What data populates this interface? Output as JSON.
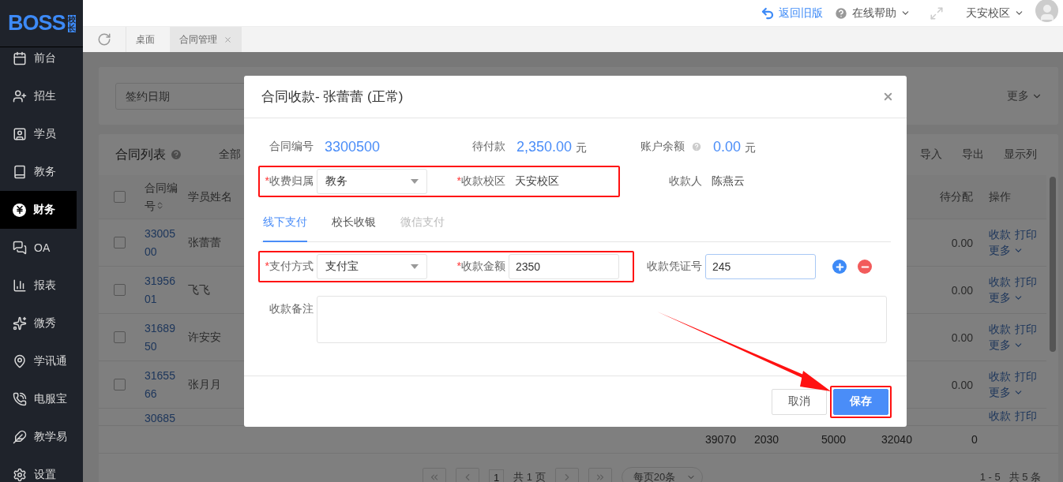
{
  "logo": {
    "text": "BOSS",
    "badge": "校长"
  },
  "sidebar": {
    "items": [
      {
        "label": "前台",
        "selected": false
      },
      {
        "label": "招生",
        "selected": false
      },
      {
        "label": "学员",
        "selected": false
      },
      {
        "label": "教务",
        "selected": false
      },
      {
        "label": "财务",
        "selected": true
      },
      {
        "label": "OA",
        "selected": false
      },
      {
        "label": "报表",
        "selected": false
      },
      {
        "label": "微秀",
        "selected": false
      },
      {
        "label": "学讯通",
        "selected": false
      },
      {
        "label": "电服宝",
        "selected": false
      },
      {
        "label": "教学易",
        "selected": false
      },
      {
        "label": "设置",
        "selected": false
      }
    ]
  },
  "header": {
    "back_link": "返回旧版",
    "help": "在线帮助",
    "campus": "天安校区"
  },
  "tabs": [
    {
      "label": "桌面",
      "selected": false,
      "closable": false
    },
    {
      "label": "合同管理",
      "selected": true,
      "closable": true
    }
  ],
  "filter": {
    "date_field": {
      "placeholder": "签约日期"
    },
    "more": "更多"
  },
  "list": {
    "title": "合同列表",
    "filter_tab": "全部",
    "select_all": {
      "checked": false
    },
    "actions": [
      "导入",
      "导出",
      "显示列"
    ],
    "columns": {
      "contract_no": "合同编号",
      "student": "学员姓名",
      "unallocated": "待分配",
      "operations": "操作"
    },
    "rows": [
      {
        "checked": false,
        "contract_no": "3300500",
        "student": "张蕾蕾",
        "unallocated": "0.00",
        "actions": [
          "收款",
          "打印"
        ],
        "more": "更多"
      },
      {
        "checked": false,
        "contract_no": "3195601",
        "student": "飞飞",
        "unallocated": "0.00",
        "actions": [
          "收款",
          "打印"
        ],
        "more": "更多"
      },
      {
        "checked": false,
        "contract_no": "3168950",
        "student": "许安安",
        "unallocated": "0.00",
        "actions": [
          "收款",
          "打印"
        ],
        "more": "更多"
      },
      {
        "checked": false,
        "contract_no": "3165566",
        "student": "张月月",
        "unallocated": "0.00",
        "actions": [
          "收款",
          "打印"
        ],
        "more": "更多"
      },
      {
        "contract_no": "30685",
        "actions": [
          "收款",
          "打印"
        ]
      }
    ],
    "totals": [
      "39070",
      "2030",
      "5000",
      "32040",
      "0"
    ],
    "pagination": {
      "page": "1",
      "total_pages": "共 1 页",
      "page_size": "每页20条",
      "summary": "1 - 5   共 5 条"
    }
  },
  "dialog": {
    "title": "合同收款- 张蕾蕾 (正常)",
    "info": [
      {
        "label": "合同编号",
        "value": "3300500"
      },
      {
        "label": "待付款",
        "value": "2,350.00",
        "unit": "元"
      },
      {
        "label": "账户余额",
        "value": "0.00",
        "unit": "元",
        "help": true
      }
    ],
    "billing_row": {
      "highlighted": true,
      "department": {
        "required_mark": "*",
        "label": "收费归属",
        "value": "教务"
      },
      "campus": {
        "required_mark": "*",
        "label": "收款校区",
        "value": "天安校区"
      }
    },
    "receiver": {
      "label": "收款人",
      "value": "陈燕云"
    },
    "tabs": [
      {
        "label": "线下支付",
        "selected": true,
        "disabled": false
      },
      {
        "label": "校长收银",
        "selected": false,
        "disabled": false
      },
      {
        "label": "微信支付",
        "selected": false,
        "disabled": true
      }
    ],
    "payment_row": {
      "highlighted": true,
      "method": {
        "required_mark": "*",
        "label": "支付方式",
        "value": "支付宝"
      },
      "amount": {
        "required_mark": "*",
        "label": "收款金额",
        "value": "2350"
      }
    },
    "voucher": {
      "label": "收款凭证号",
      "value": "245",
      "focused": true
    },
    "note": {
      "label": "收款备注"
    },
    "buttons": {
      "cancel": "取消",
      "save": "保存",
      "save_highlighted": true
    },
    "annotation_arrow": true
  }
}
